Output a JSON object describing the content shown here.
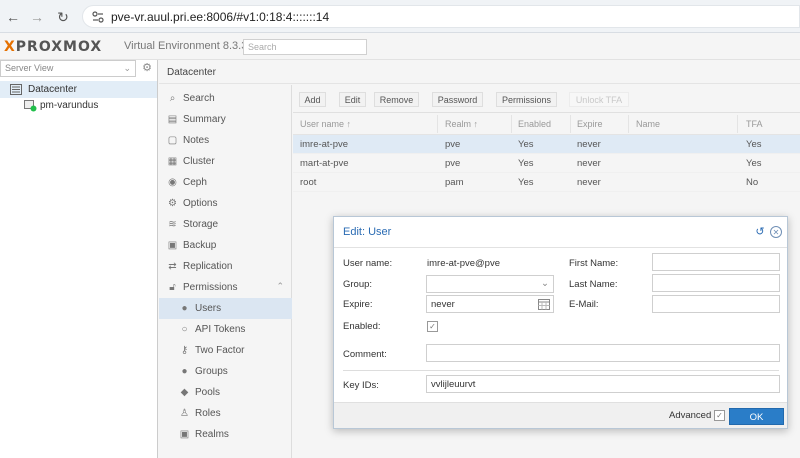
{
  "browser": {
    "url": "pve-vr.auul.pri.ee:8006/#v1:0:18:4:::::::14"
  },
  "header": {
    "logo_text_x": "X",
    "logo_text": "PROXMOX",
    "version": "Virtual Environment 8.3.3",
    "search_placeholder": "Search"
  },
  "tree": {
    "view_label": "Server View",
    "items": [
      {
        "label": "Datacenter"
      },
      {
        "label": "pm-varundus"
      }
    ]
  },
  "datacenter_title": "Datacenter",
  "menu": [
    {
      "label": "Search",
      "icon": "search-icon"
    },
    {
      "label": "Summary",
      "icon": "book-icon"
    },
    {
      "label": "Notes",
      "icon": "notes-icon"
    },
    {
      "label": "Cluster",
      "icon": "server-icon"
    },
    {
      "label": "Ceph",
      "icon": "ceph-icon"
    },
    {
      "label": "Options",
      "icon": "gear-icon"
    },
    {
      "label": "Storage",
      "icon": "database-icon"
    },
    {
      "label": "Backup",
      "icon": "floppy-icon"
    },
    {
      "label": "Replication",
      "icon": "retweet-icon"
    },
    {
      "label": "Permissions",
      "icon": "unlock-icon"
    },
    {
      "label": "Users",
      "icon": "user-icon"
    },
    {
      "label": "API Tokens",
      "icon": "user-outline-icon"
    },
    {
      "label": "Two Factor",
      "icon": "key-icon"
    },
    {
      "label": "Groups",
      "icon": "users-icon"
    },
    {
      "label": "Pools",
      "icon": "tags-icon"
    },
    {
      "label": "Roles",
      "icon": "male-icon"
    },
    {
      "label": "Realms",
      "icon": "address-book-icon"
    }
  ],
  "toolbar": {
    "add": "Add",
    "edit": "Edit",
    "remove": "Remove",
    "password": "Password",
    "permissions": "Permissions",
    "unlock_tfa": "Unlock TFA"
  },
  "grid": {
    "columns": [
      "User name ↑",
      "Realm ↑",
      "Enabled",
      "Expire",
      "Name",
      "TFA"
    ],
    "rows": [
      [
        "imre-at-pve",
        "pve",
        "Yes",
        "never",
        "",
        "Yes"
      ],
      [
        "mart-at-pve",
        "pve",
        "Yes",
        "never",
        "",
        "Yes"
      ],
      [
        "root",
        "pam",
        "Yes",
        "never",
        "",
        "No"
      ]
    ]
  },
  "dialog": {
    "title": "Edit: User",
    "username_label": "User name:",
    "username_value": "imre-at-pve@pve",
    "group_label": "Group:",
    "group_value": "",
    "expire_label": "Expire:",
    "expire_value": "never",
    "enabled_label": "Enabled:",
    "firstname_label": "First Name:",
    "firstname_value": "",
    "lastname_label": "Last Name:",
    "lastname_value": "",
    "email_label": "E-Mail:",
    "email_value": "",
    "comment_label": "Comment:",
    "comment_value": "",
    "keyids_label": "Key IDs:",
    "keyids_value": "vvlijleuurvt",
    "advanced_label": "Advanced",
    "ok_label": "OK"
  },
  "colors": {
    "accent": "#2a7dc8",
    "logo_orange": "#e57000",
    "selected_row": "#dfeaf5"
  }
}
